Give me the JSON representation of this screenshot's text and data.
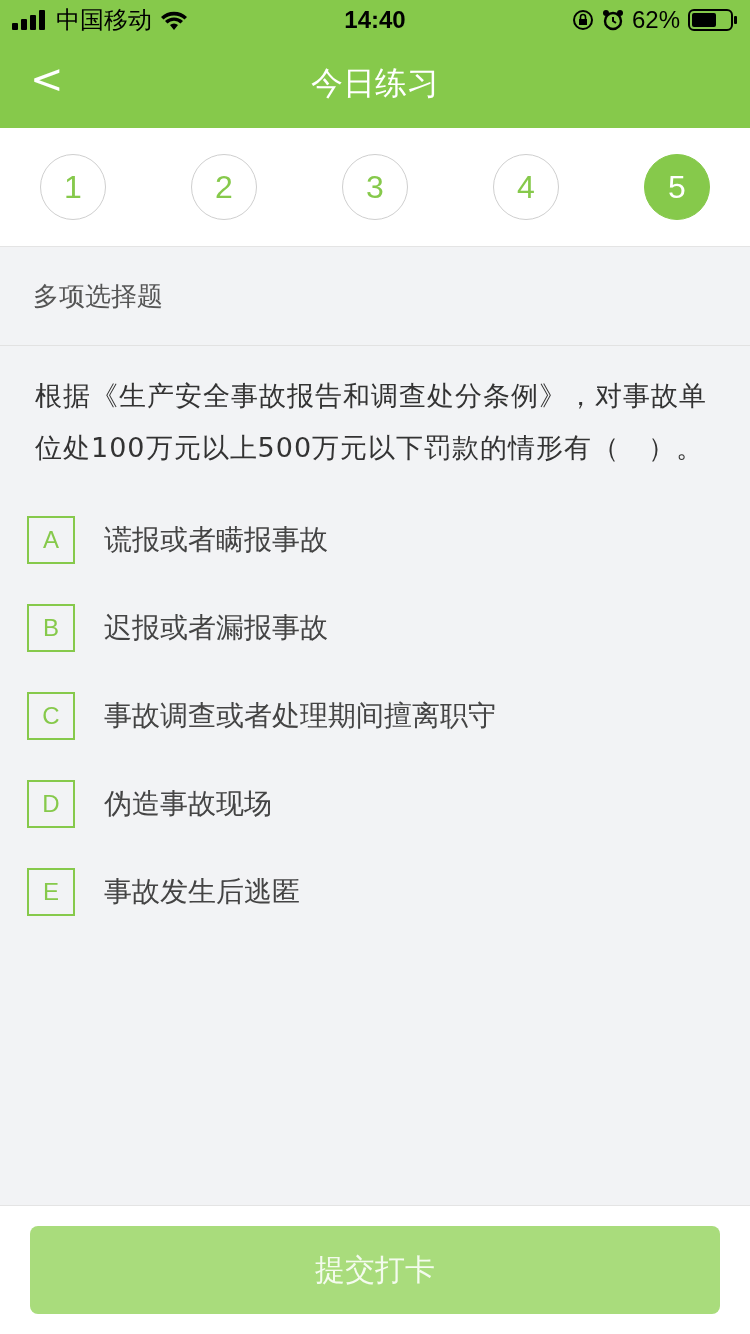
{
  "status_bar": {
    "carrier": "中国移动",
    "time": "14:40",
    "battery": "62%"
  },
  "header": {
    "back": "<",
    "title": "今日练习"
  },
  "steps": [
    {
      "label": "1",
      "selected": false
    },
    {
      "label": "2",
      "selected": false
    },
    {
      "label": "3",
      "selected": false
    },
    {
      "label": "4",
      "selected": false
    },
    {
      "label": "5",
      "selected": true
    }
  ],
  "question": {
    "type_label": "多项选择题",
    "text": "根据《生产安全事故报告和调查处分条例》，对事故单位处100万元以上500万元以下罚款的情形有（　）。",
    "options": [
      {
        "letter": "A",
        "text": "谎报或者瞒报事故",
        "selected": false
      },
      {
        "letter": "B",
        "text": "迟报或者漏报事故",
        "selected": false
      },
      {
        "letter": "C",
        "text": "事故调查或者处理期间擅离职守",
        "selected": false
      },
      {
        "letter": "D",
        "text": "伪造事故现场",
        "selected": false
      },
      {
        "letter": "E",
        "text": "事故发生后逃匿",
        "selected": false
      }
    ]
  },
  "submit": {
    "label": "提交打卡",
    "disabled": true
  }
}
